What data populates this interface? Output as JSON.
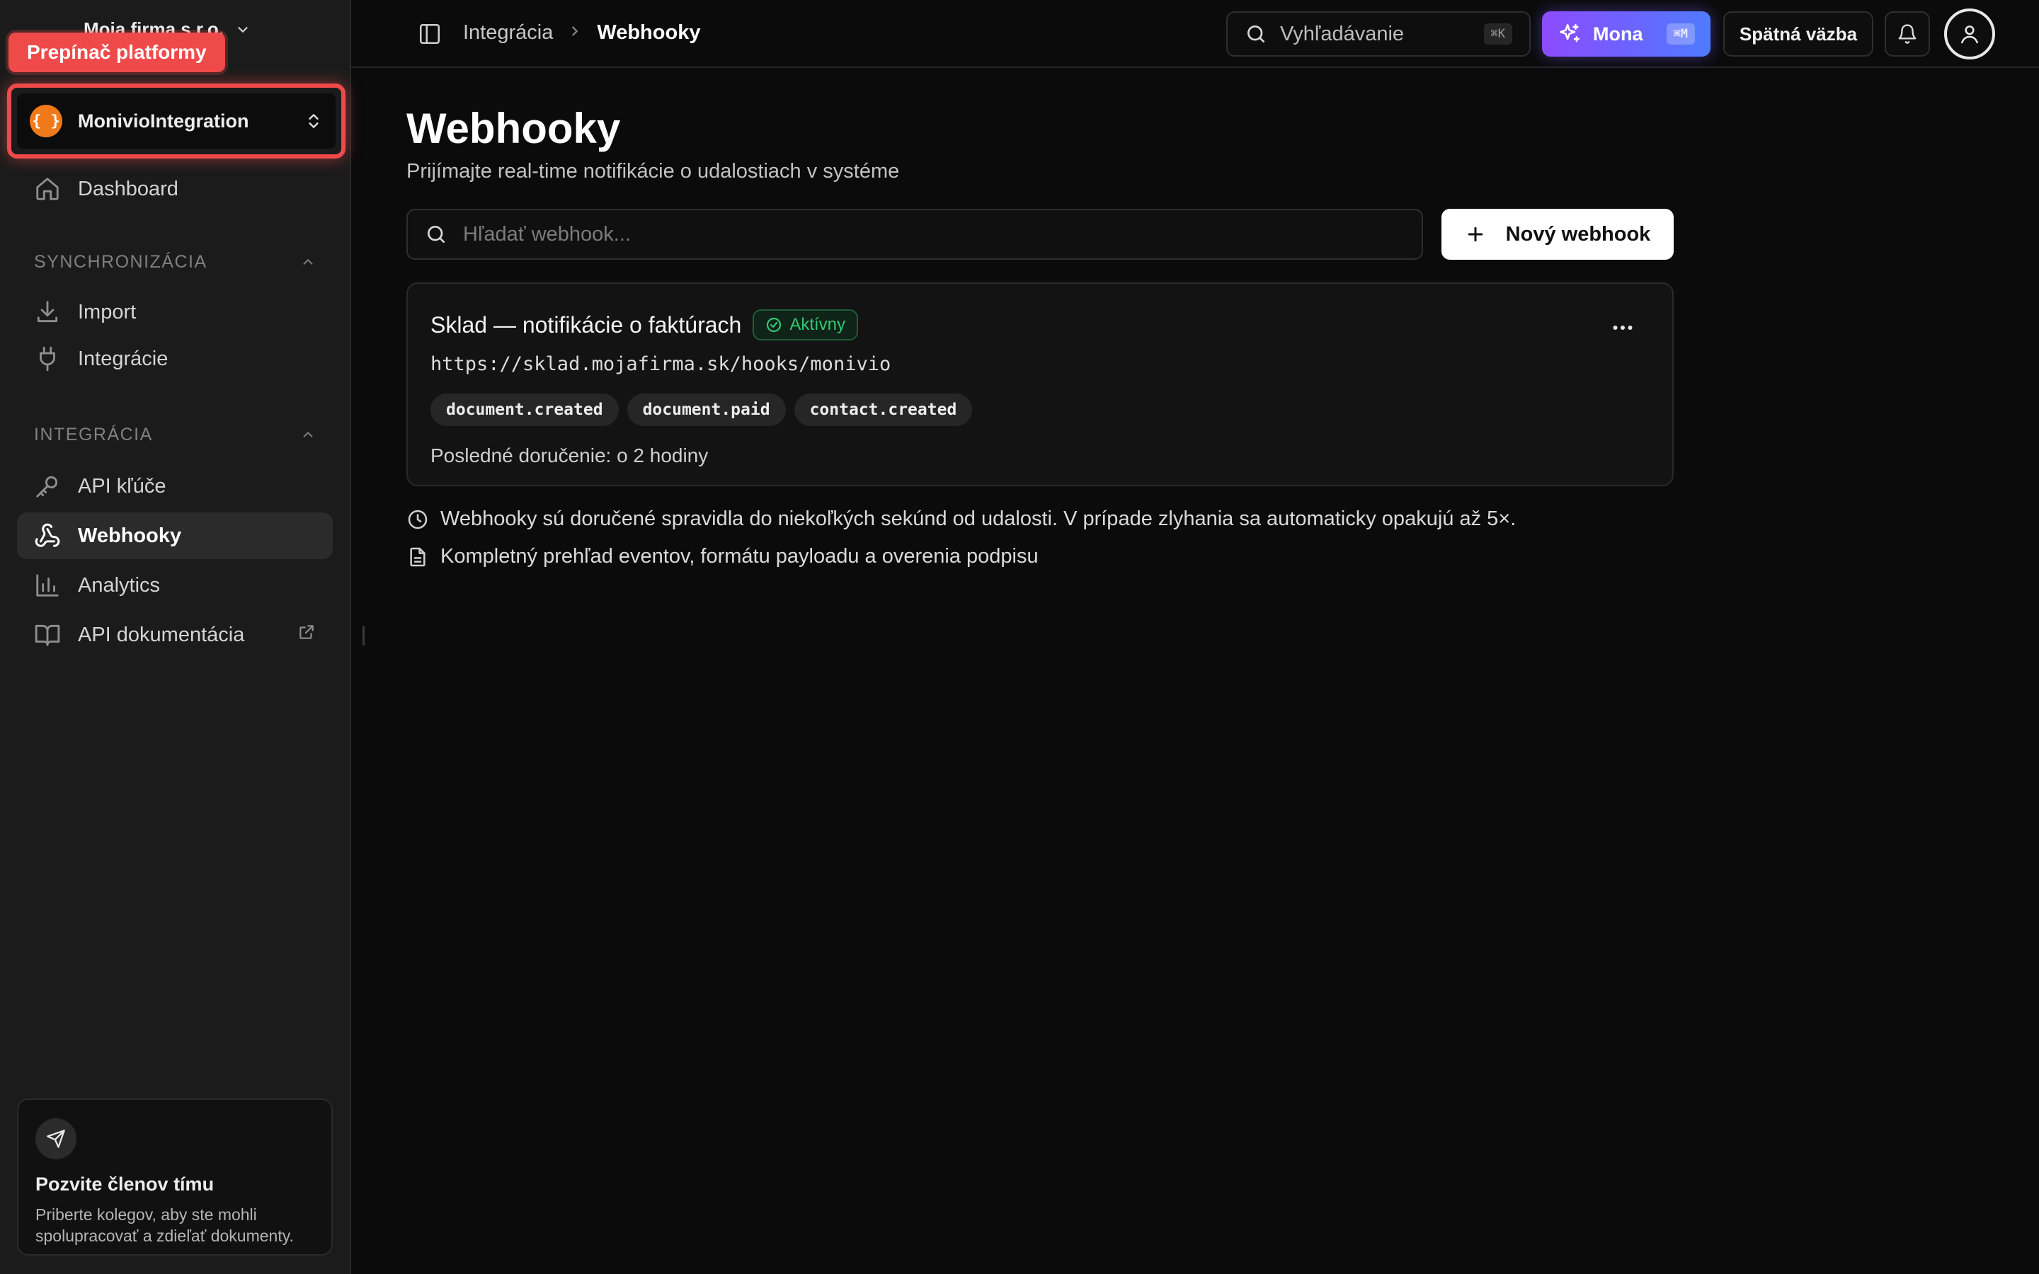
{
  "sidebar": {
    "org_name": "Moja firma s.r.o.",
    "tooltip": "Prepínač platformy",
    "platform_switcher": {
      "logo_text": "{ }",
      "name": "MonivioIntegration",
      "icon": "chevrons-up-down-icon"
    },
    "nav_dashboard": {
      "label": "Dashboard",
      "icon": "home-icon"
    },
    "section_sync": {
      "label": "SYNCHRONIZÁCIA",
      "items": [
        {
          "label": "Import",
          "icon": "download-icon"
        },
        {
          "label": "Integrácie",
          "icon": "plug-icon"
        }
      ]
    },
    "section_integration": {
      "label": "INTEGRÁCIA",
      "items": [
        {
          "label": "API kľúče",
          "icon": "key-icon",
          "active": false
        },
        {
          "label": "Webhooky",
          "icon": "webhook-icon",
          "active": true
        },
        {
          "label": "Analytics",
          "icon": "bar-chart-icon",
          "active": false
        },
        {
          "label": "API dokumentácia",
          "icon": "book-icon",
          "active": false,
          "external": true
        }
      ]
    },
    "invite": {
      "title": "Pozvite členov tímu",
      "text": "Priberte kolegov, aby ste mohli spolupracovať a zdieľať dokumenty."
    }
  },
  "header": {
    "breadcrumb": [
      "Integrácia",
      "Webhooky"
    ],
    "search": {
      "placeholder": "Vyhľadávanie",
      "shortcut": "⌘K"
    },
    "mona": {
      "label": "Mona",
      "shortcut": "⌘M"
    },
    "feedback_label": "Spätná väzba"
  },
  "main": {
    "title": "Webhooky",
    "subtitle": "Prijímajte real-time notifikácie o udalostiach v systéme",
    "search_placeholder": "Hľadať webhook...",
    "new_button_label": "Nový webhook",
    "webhooks": [
      {
        "name": "Sklad — notifikácie o faktúrach",
        "status": "Aktívny",
        "url": "https://sklad.mojafirma.sk/hooks/monivio",
        "events": [
          "document.created",
          "document.paid",
          "contact.created"
        ],
        "last_delivery": "Posledné doručenie: o 2 hodiny"
      }
    ],
    "info_delivery": "Webhooky sú doručené spravidla do niekoľkých sekúnd od udalosti. V prípade zlyhania sa automaticky opakujú až 5×.",
    "info_docs": "Kompletný prehľad eventov, formátu payloadu a overenia podpisu"
  },
  "colors": {
    "background": "#0b0b0b",
    "sidebar": "#1b1b1b",
    "highlight": "#ef4a4a",
    "status_active": "#33c872",
    "mona_gradient": [
      "#8c4bff",
      "#4f7bff"
    ],
    "logo": "#f07a1a"
  }
}
